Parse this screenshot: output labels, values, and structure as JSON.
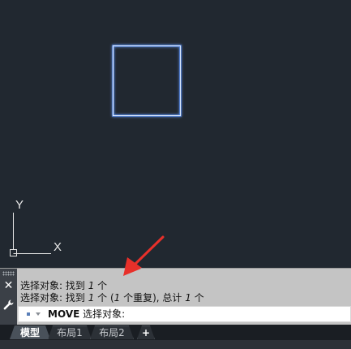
{
  "canvas": {
    "ucs": {
      "y_label": "Y",
      "x_label": "X"
    },
    "colors": {
      "background": "#212830",
      "object_stroke": "#d8e6ff",
      "object_glow": "#4d7dd8",
      "ucs": "#e6e6e6",
      "arrow": "#e8302a"
    }
  },
  "command_line": {
    "history": [
      {
        "prefix": "选择对象: 找到 ",
        "count": "1",
        "suffix": " 个"
      },
      {
        "prefix": "选择对象: 找到 ",
        "count": "1",
        "middle": " 个 (",
        "count2": "1",
        "suffix": " 个重复), 总计 ",
        "count3": "1",
        "suffix2": " 个"
      }
    ],
    "input": {
      "command": "MOVE",
      "prompt": "选择对象:"
    },
    "close_glyph": "✕"
  },
  "tabs": [
    {
      "label": "模型",
      "active": true
    },
    {
      "label": "布局1",
      "active": false
    },
    {
      "label": "布局2",
      "active": false
    }
  ],
  "add_tab_label": "+"
}
